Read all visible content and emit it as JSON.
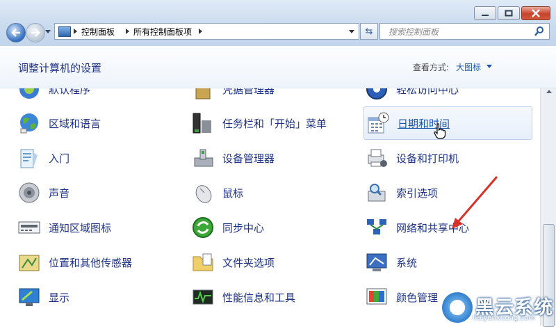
{
  "window": {
    "min_icon": "minimize-icon",
    "max_icon": "maximize-icon",
    "close_icon": "close-icon"
  },
  "address": {
    "crumbs": [
      "控制面板",
      "所有控制面板项"
    ],
    "search_placeholder": "搜索控制面板"
  },
  "header": {
    "title": "调整计算机的设置",
    "view_label": "查看方式:",
    "view_value": "大图标"
  },
  "items": [
    {
      "label": "默认程序",
      "icon": "default-programs-icon"
    },
    {
      "label": "凭据管理器",
      "icon": "credential-manager-icon"
    },
    {
      "label": "轻松访问中心",
      "icon": "ease-of-access-icon"
    },
    {
      "label": "区域和语言",
      "icon": "globe-icon"
    },
    {
      "label": "任务栏和「开始」菜单",
      "icon": "taskbar-icon"
    },
    {
      "label": "日期和时间",
      "icon": "calendar-clock-icon"
    },
    {
      "label": "入门",
      "icon": "getting-started-icon"
    },
    {
      "label": "设备管理器",
      "icon": "device-manager-icon"
    },
    {
      "label": "设备和打印机",
      "icon": "printer-icon"
    },
    {
      "label": "声音",
      "icon": "speaker-icon"
    },
    {
      "label": "鼠标",
      "icon": "mouse-icon"
    },
    {
      "label": "索引选项",
      "icon": "indexing-icon"
    },
    {
      "label": "通知区域图标",
      "icon": "notification-area-icon"
    },
    {
      "label": "同步中心",
      "icon": "sync-icon"
    },
    {
      "label": "网络和共享中心",
      "icon": "network-icon"
    },
    {
      "label": "位置和其他传感器",
      "icon": "location-sensor-icon"
    },
    {
      "label": "文件夹选项",
      "icon": "folder-options-icon"
    },
    {
      "label": "系统",
      "icon": "system-icon"
    },
    {
      "label": "显示",
      "icon": "display-icon"
    },
    {
      "label": "性能信息和工具",
      "icon": "performance-icon"
    },
    {
      "label": "颜色管理",
      "icon": "color-management-icon"
    }
  ],
  "hovered_item": "日期和时间",
  "watermark": {
    "text": "黑云系统",
    "url": "heiyunxitong.com"
  },
  "colors": {
    "link": "#1e3287",
    "accent": "#1a55b0",
    "arrow": "#d9302a"
  }
}
